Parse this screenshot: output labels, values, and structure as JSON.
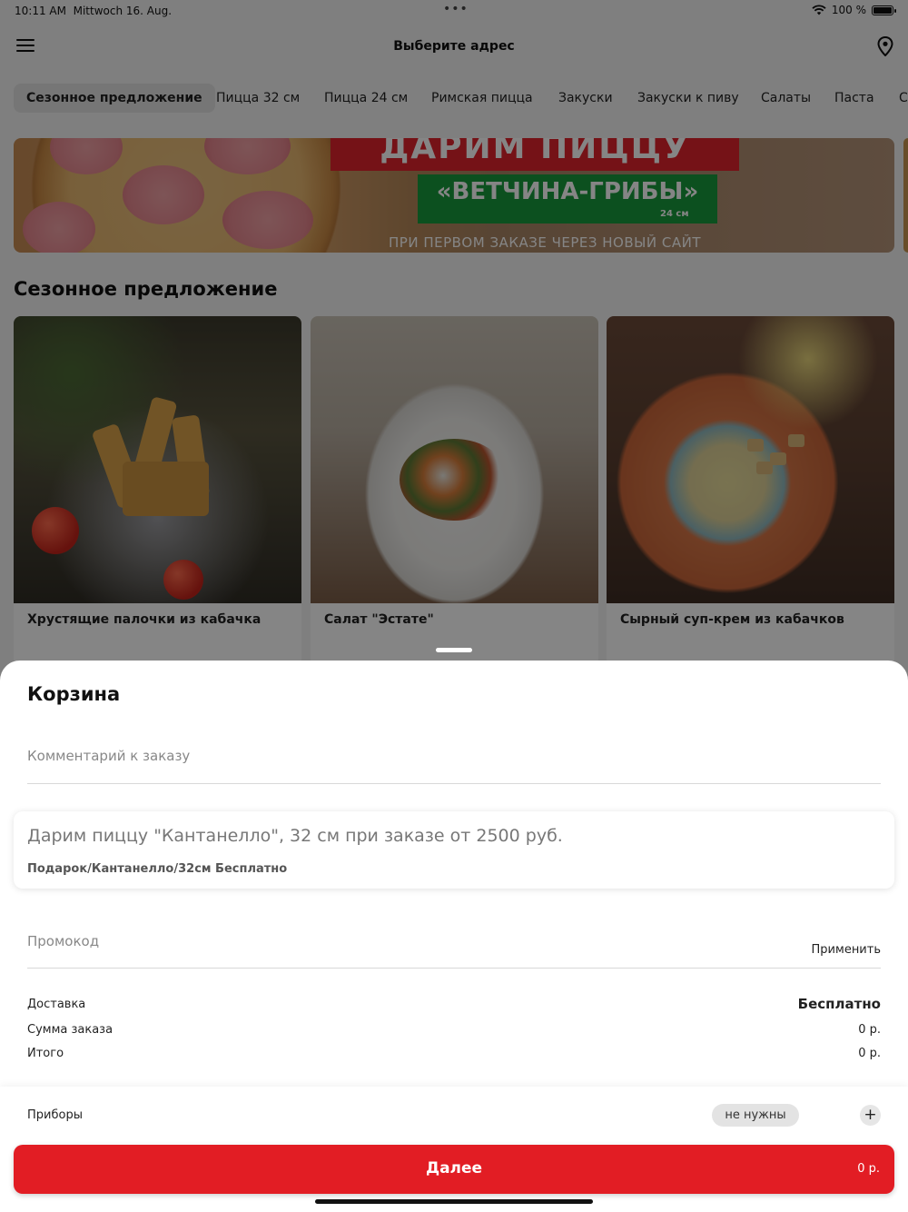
{
  "status_bar": {
    "time": "10:11 AM",
    "date": "Mittwoch 16. Aug.",
    "battery": "100 %",
    "more_icon": "ellipsis-icon"
  },
  "header": {
    "address_label": "Выберите адрес",
    "menu_icon": "hamburger-icon",
    "location_icon": "map-pin-icon"
  },
  "categories": [
    {
      "label": "Сезонное предложение",
      "active": true
    },
    {
      "label": "Пицца 32 см",
      "active": false
    },
    {
      "label": "Пицца 24 см",
      "active": false
    },
    {
      "label": "Римская пицца",
      "active": false
    },
    {
      "label": "Закуски",
      "active": false
    },
    {
      "label": "Закуски к пиву",
      "active": false
    },
    {
      "label": "Салаты",
      "active": false
    },
    {
      "label": "Паста",
      "active": false
    },
    {
      "label": "С",
      "active": false
    }
  ],
  "banner": {
    "headline": "ДАРИМ ПИЦЦУ",
    "product": "«ВЕТЧИНА-ГРИБЫ»",
    "size": "24 см",
    "note": "ПРИ ПЕРВОМ ЗАКАЗЕ ЧЕРЕЗ НОВЫЙ САЙТ"
  },
  "section": {
    "title": "Сезонное предложение",
    "products": [
      {
        "name": "Хрустящие палочки из кабачка"
      },
      {
        "name": "Салат \"Эстате\""
      },
      {
        "name": "Сырный суп-крем из кабачков"
      }
    ]
  },
  "cart": {
    "title": "Корзина",
    "comment_placeholder": "Комментарий к заказу",
    "gift": {
      "title": "Дарим пиццу \"Кантанелло\", 32 см при заказе от 2500 руб.",
      "item": "Подарок/Кантанелло/32см Бесплатно"
    },
    "promo_placeholder": "Промокод",
    "apply_label": "Применить",
    "summary": [
      {
        "label": "Доставка",
        "value": "Бесплатно"
      },
      {
        "label": "Сумма заказа",
        "value": "0 р."
      },
      {
        "label": "Итого",
        "value": "0 р."
      }
    ],
    "utensils": {
      "label": "Приборы",
      "value": "не нужны",
      "add_symbol": "+"
    },
    "next_button": {
      "label": "Далее",
      "price": "0 р."
    }
  },
  "colors": {
    "accent": "#e21d24",
    "gift_green": "#179a3c"
  }
}
